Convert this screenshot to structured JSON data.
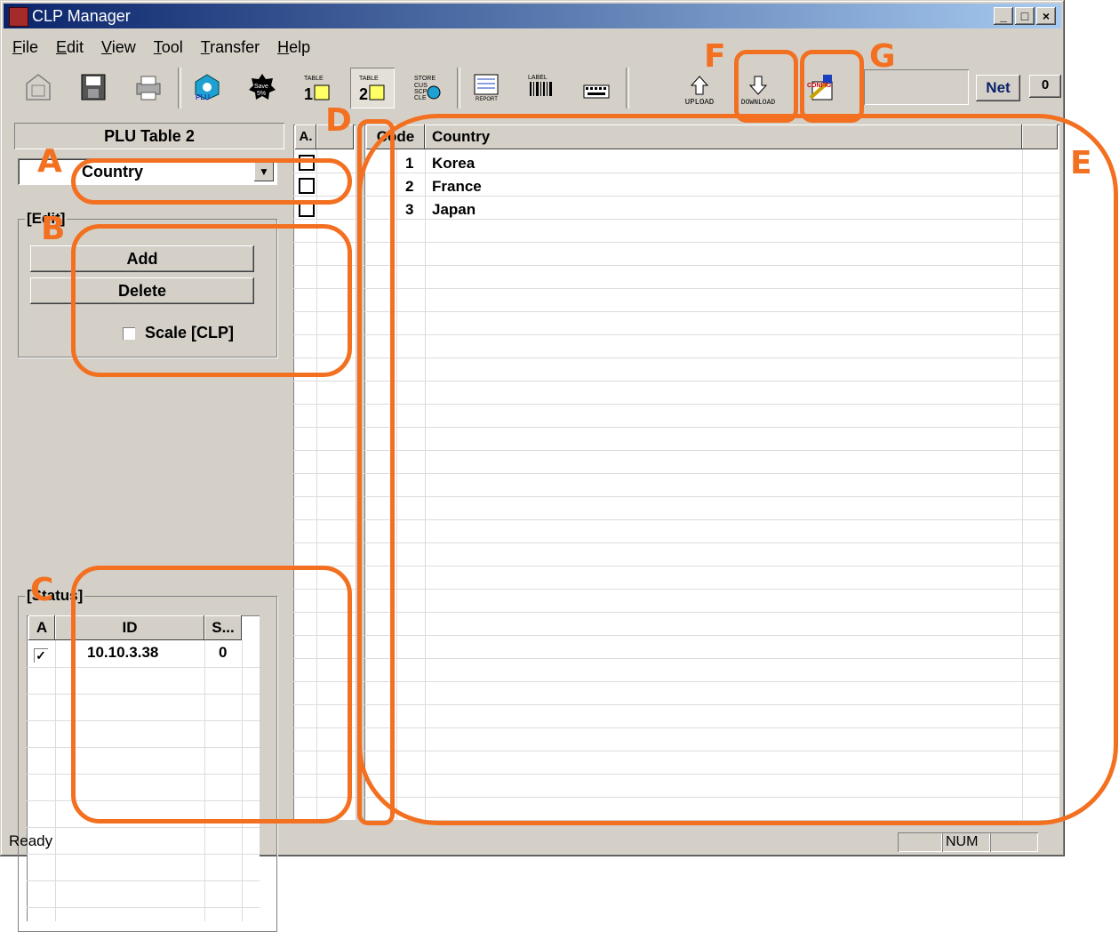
{
  "window": {
    "title": "CLP Manager",
    "controls": [
      "_",
      "□",
      "×"
    ]
  },
  "menu": [
    "File",
    "Edit",
    "View",
    "Tool",
    "Transfer",
    "Help"
  ],
  "toolbar": {
    "buttons": [
      {
        "name": "open-button",
        "label": "OPEN"
      },
      {
        "name": "save-button",
        "label": ""
      },
      {
        "name": "print-button",
        "label": ""
      },
      {
        "name": "plu-button",
        "label": "PLU"
      },
      {
        "name": "discount-button",
        "label": "Save 5%"
      },
      {
        "name": "table1-button",
        "label": "TABLE 1"
      },
      {
        "name": "table2-button",
        "label": "TABLE 2"
      },
      {
        "name": "store-button",
        "label": "STORE CUS SCP CLE"
      },
      {
        "name": "report-button",
        "label": "REPORT"
      },
      {
        "name": "label-button",
        "label": "LABEL"
      },
      {
        "name": "keyboard-button",
        "label": ""
      },
      {
        "name": "upload-button",
        "label": "UPLOAD"
      },
      {
        "name": "download-button",
        "label": "DOWNLOAD"
      },
      {
        "name": "config-button",
        "label": "CONFIG"
      }
    ],
    "net_label": "Net",
    "zero_label": "0"
  },
  "left": {
    "title": "PLU Table 2",
    "combo_value": "Country",
    "edit_group": "[Edit]",
    "add_label": "Add",
    "delete_label": "Delete",
    "scale_label": "Scale [CLP]",
    "status_group": "[Status]",
    "status_headers": [
      "A",
      "ID",
      "S..."
    ],
    "status_rows": [
      {
        "id": "10.10.3.38",
        "s": "0",
        "checked": true
      }
    ]
  },
  "middle": {
    "header": "A."
  },
  "grid": {
    "headers": [
      "Code",
      "Country"
    ],
    "rows": [
      {
        "code": "1",
        "country": "Korea"
      },
      {
        "code": "2",
        "country": "France"
      },
      {
        "code": "3",
        "country": "Japan"
      }
    ]
  },
  "statusbar": {
    "text": "Ready",
    "num": "NUM"
  },
  "annotations": [
    "A",
    "B",
    "C",
    "D",
    "E",
    "F",
    "G"
  ],
  "colors": {
    "annotation": "#f37021",
    "title_start": "#0a246a",
    "title_end": "#a6caf0"
  }
}
